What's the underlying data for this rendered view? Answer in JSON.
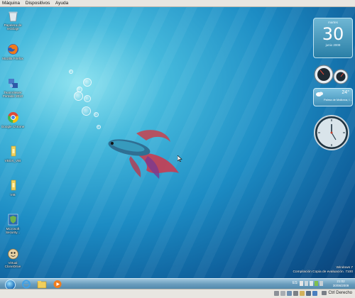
{
  "vm_menu": {
    "items": [
      {
        "label": "Máquina"
      },
      {
        "label": "Dispositivos"
      },
      {
        "label": "Ayuda"
      }
    ]
  },
  "desktop": {
    "icons": [
      {
        "label": "Papelera de reciclaje",
        "icon": "recycle-bin-icon"
      },
      {
        "label": "Mozilla Firefox",
        "icon": "firefox-icon"
      },
      {
        "label": "TeamViewer Portable 2010",
        "icon": "teamviewer-icon"
      },
      {
        "label": "Google Chrome",
        "icon": "chrome-icon"
      },
      {
        "label": "VBOX_VIB",
        "icon": "folder-icon"
      },
      {
        "label": "VIB",
        "icon": "folder-icon"
      },
      {
        "label": "Microsoft Security...",
        "icon": "security-essentials-icon"
      },
      {
        "label": "Virtual CloneDrive",
        "icon": "clonedrive-icon"
      }
    ]
  },
  "gadgets": {
    "calendar": {
      "weekday": "martes",
      "day": "30",
      "month_year": "junio 2009"
    },
    "weather": {
      "temp": "24°",
      "place": "Palma de Mallorca, I..."
    }
  },
  "watermark": {
    "line1": "Windows 7",
    "line2": "Compilación Copia de evaluación. 7100"
  },
  "taskbar": {
    "lang": "ES",
    "time": "21:02",
    "date": "30/06/2009"
  },
  "statusbar": {
    "host_key": "Ctrl Derecho"
  },
  "colors": {
    "accent": "#1c8cc4",
    "taskbar": "#6a9dbd",
    "chrome_bar": "#e8e6e1"
  }
}
